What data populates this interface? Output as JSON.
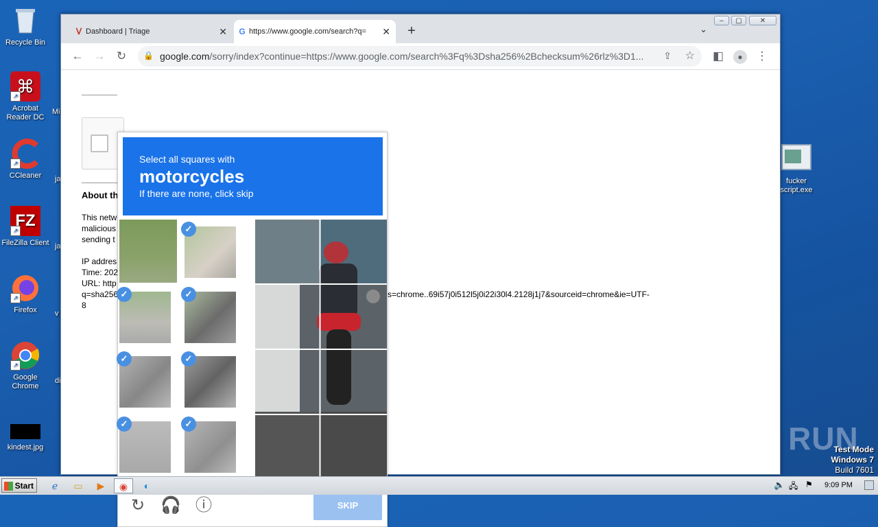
{
  "desktop": {
    "icons": [
      {
        "label": "Recycle Bin"
      },
      {
        "label": "Acrobat Reader DC"
      },
      {
        "label": "CCleaner"
      },
      {
        "label": "FileZilla Client"
      },
      {
        "label": "Firefox"
      },
      {
        "label": "Google Chrome"
      },
      {
        "label": "kindest.jpg"
      },
      {
        "label": "fucker script.exe"
      }
    ],
    "edge_labels": [
      "Mi",
      "ja",
      "ja",
      "v",
      "di"
    ]
  },
  "browser": {
    "tabs": [
      {
        "title": "Dashboard | Triage",
        "close": "✕"
      },
      {
        "title": "https://www.google.com/search?q=",
        "close": "✕"
      }
    ],
    "new_tab": "+",
    "url_host": "google.com",
    "url_rest": "/sorry/index?continue=https://www.google.com/search%3Fq%3Dsha256%2Bchecksum%26rlz%3D1..."
  },
  "page": {
    "heading": "About th",
    "para": "This netw\nmalicious\nsending t",
    "info": "IP addres\nTime: 202\nURL: http\nq=sha256",
    "url_tail": "s=chrome..69i57j0i512l5j0i22i30l4.2128j1j7&sourceid=chrome&ie=UTF-",
    "url_tail2": "8"
  },
  "captcha": {
    "line1": "Select all squares with",
    "line2": "motorcycles",
    "line3": "If there are none, click skip",
    "skip_label": "SKIP",
    "checkmark": "✓"
  },
  "taskbar": {
    "start_label": "Start",
    "clock": "9:09 PM"
  },
  "watermark": "ANY RUN",
  "system": {
    "line1": "Test Mode",
    "line2": "Windows 7",
    "line3": "Build 7601"
  }
}
